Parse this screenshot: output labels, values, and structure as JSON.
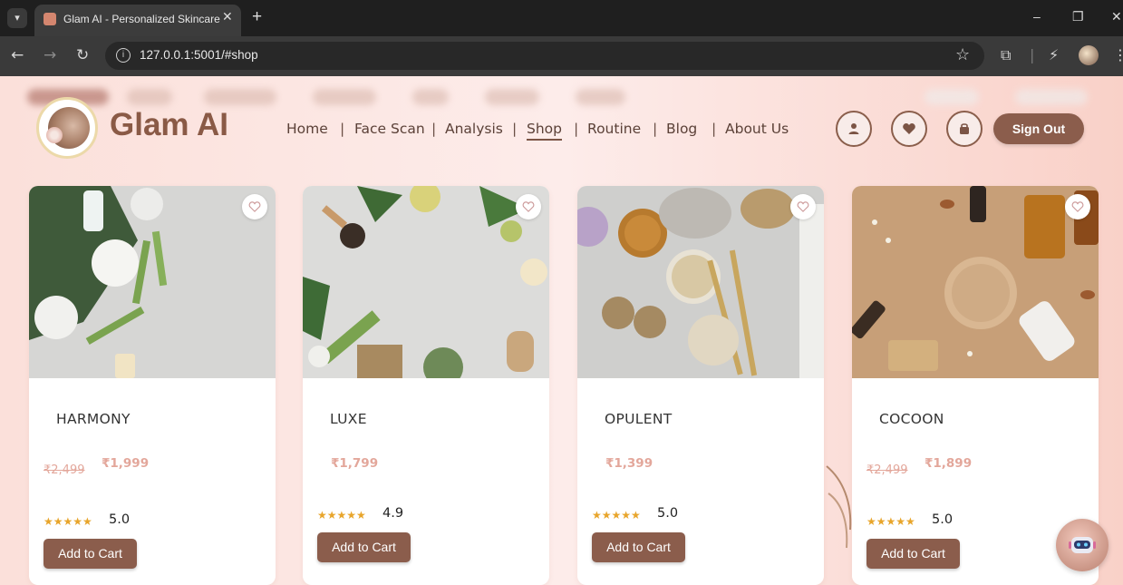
{
  "browser": {
    "tab_title": "Glam AI - Personalized Skincare",
    "tab_close": "✕",
    "new_tab": "+",
    "url": "127.0.0.1:5001/#shop",
    "window_controls": [
      "–",
      "❐",
      "✕"
    ]
  },
  "header": {
    "brand": "Glam AI",
    "nav": [
      "Home",
      "Face Scan",
      "Analysis",
      "Shop",
      "Routine",
      "Blog",
      "About Us"
    ],
    "active_nav": "Shop",
    "separator": "|",
    "signout_label": "Sign Out",
    "icons": [
      "user-icon",
      "heart-icon",
      "bag-icon"
    ]
  },
  "products": [
    {
      "name": "HARMONY",
      "old_price": "₹2,499",
      "price": "₹1,999",
      "stars": "★★★★★",
      "rating": "5.0",
      "cart": "Add to Cart"
    },
    {
      "name": "LUXE",
      "old_price": "",
      "price": "₹1,799",
      "stars": "★★★★★",
      "rating": "4.9",
      "cart": "Add to Cart"
    },
    {
      "name": "OPULENT",
      "old_price": "",
      "price": "₹1,399",
      "stars": "★★★★★",
      "rating": "5.0",
      "cart": "Add to Cart"
    },
    {
      "name": "COCOON",
      "old_price": "₹2,499",
      "price": "₹1,899",
      "stars": "★★★★★",
      "rating": "5.0",
      "cart": "Add to Cart"
    }
  ],
  "colors": {
    "accent": "#8b5d4c",
    "price": "#e3a79b",
    "star": "#e8a52b"
  }
}
